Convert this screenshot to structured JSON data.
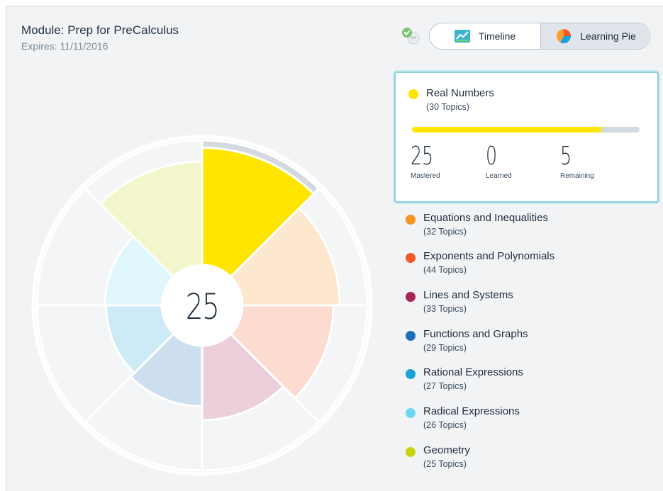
{
  "header": {
    "title": "Module: Prep for PreCalculus",
    "expires": "Expires: 11/11/2016"
  },
  "toggle": {
    "timeline_label": "Timeline",
    "pie_label": "Learning Pie",
    "selected": "Learning Pie"
  },
  "pie": {
    "center_value": "25"
  },
  "selected_topic": {
    "name": "Real Numbers",
    "topics": "(30 Topics)",
    "color": "#ffe500",
    "progress_fraction": 0.833,
    "mastered_value": "25",
    "mastered_label": "Mastered",
    "learned_value": "0",
    "learned_label": "Learned",
    "remaining_value": "5",
    "remaining_label": "Remaining"
  },
  "legend": [
    {
      "name": "Equations and Inequalities",
      "topics": "(32 Topics)",
      "color": "#f7931e"
    },
    {
      "name": "Exponents and Polynomials",
      "topics": "(44 Topics)",
      "color": "#f05a28"
    },
    {
      "name": "Lines and Systems",
      "topics": "(33 Topics)",
      "color": "#a8245a"
    },
    {
      "name": "Functions and Graphs",
      "topics": "(29 Topics)",
      "color": "#1c6fb5"
    },
    {
      "name": "Rational Expressions",
      "topics": "(27 Topics)",
      "color": "#1aa3d6"
    },
    {
      "name": "Radical Expressions",
      "topics": "(26 Topics)",
      "color": "#6fd6f2"
    },
    {
      "name": "Geometry",
      "topics": "(25 Topics)",
      "color": "#c5d60f"
    }
  ]
}
